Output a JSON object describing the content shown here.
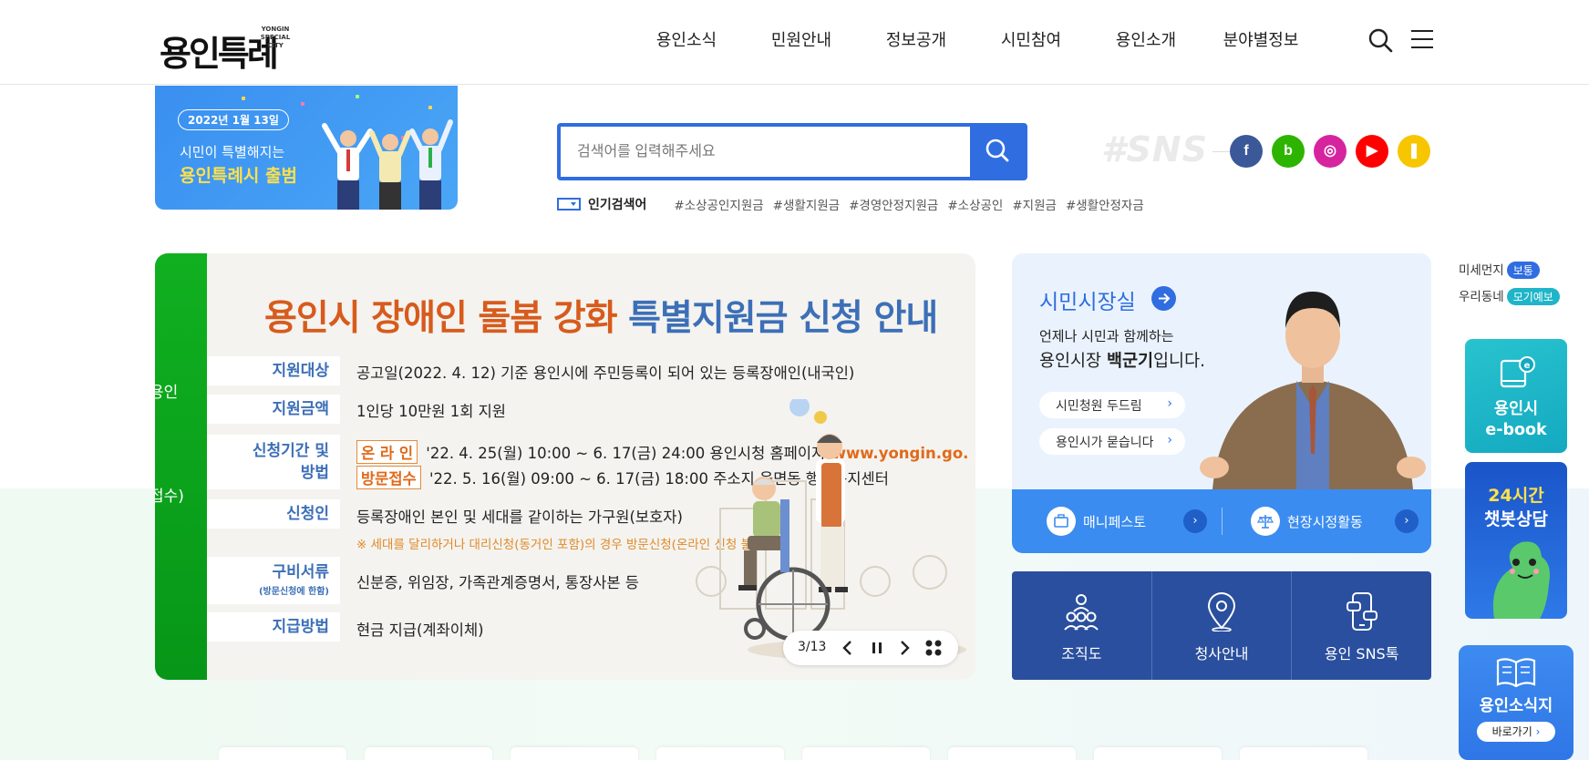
{
  "header": {
    "logo_text": "용인특례시",
    "logo_sub": "YONGIN SPECIAL CITY",
    "nav": [
      "용인소식",
      "민원안내",
      "정보공개",
      "시민참여",
      "용인소개",
      "분야별정보"
    ]
  },
  "promo": {
    "date": "2022년 1월 13일",
    "line1": "시민이 특별해지는",
    "line2": "용인특례시 출범"
  },
  "search": {
    "placeholder": "검색어를 입력해주세요",
    "popular_title": "인기검색어",
    "tags": [
      "#소상공인지원금",
      "#생활지원금",
      "#경영안정지원금",
      "#소상공인",
      "#지원금",
      "#생활안정자금"
    ]
  },
  "sns": {
    "label": "#SNS",
    "items": [
      {
        "name": "facebook",
        "glyph": "f",
        "color": "#3b5998"
      },
      {
        "name": "blog",
        "glyph": "b",
        "color": "#2db400"
      },
      {
        "name": "instagram",
        "glyph": "◎",
        "color": "#d6249f"
      },
      {
        "name": "youtube",
        "glyph": "▶",
        "color": "#ff0000"
      },
      {
        "name": "kakao",
        "glyph": "❚",
        "color": "#f7c600"
      }
    ]
  },
  "slider": {
    "strip_text_1": "용인",
    "strip_text_2": "접수)",
    "title_part1": "용인시 장애인 돌봄 강화",
    "title_part2": "특별지원금 신청 안내",
    "rows": {
      "target_label": "지원대상",
      "target_value": "공고일(2022. 4. 12) 기준 용인시에 주민등록이 되어 있는 등록장애인(내국인)",
      "amount_label": "지원금액",
      "amount_value": "1인당 10만원 1회 지원",
      "period_label_1": "신청기간 및",
      "period_label_2": "방법",
      "online_pill": "온 라 인",
      "online_text": "'22. 4. 25(월) 10:00 ~ 6. 17(금) 24:00 용인시청 홈페이지",
      "online_url": "(www.yongin.go.",
      "visit_pill": "방문접수",
      "visit_text": "'22. 5. 16(월) 09:00 ~ 6. 17(금) 18:00 주소지 읍면동 행정복지센터",
      "applicant_label": "신청인",
      "applicant_value": "등록장애인 본인 및 세대를 같이하는 가구원(보호자)",
      "applicant_note": "※ 세대를 달리하거나 대리신청(동거인 포함)의 경우 방문신청(온라인 신청 불가)",
      "docs_label": "구비서류",
      "docs_sub": "(방문신청에 한함)",
      "docs_value": "신분증, 위임장, 가족관계증명서, 통장사본 등",
      "pay_label": "지급방법",
      "pay_value": "현금 지급(계좌이체)"
    },
    "page": "3/13"
  },
  "mayor": {
    "title": "시민시장실",
    "desc1": "언제나 시민과 함께하는",
    "desc2_pre": "용인시장 ",
    "desc2_name": "백군기",
    "desc2_post": "입니다.",
    "link1": "시민청원 두드림",
    "link2": "용인시가 묻습니다",
    "bar_item1": "매니페스토",
    "bar_item2": "현장시정활동"
  },
  "quick": [
    {
      "label": "조직도",
      "icon": "org-chart-icon"
    },
    {
      "label": "청사안내",
      "icon": "map-pin-icon"
    },
    {
      "label": "용인 SNS톡",
      "icon": "smartphone-icon"
    }
  ],
  "side": {
    "dust_label": "미세먼지",
    "dust_status": "보통",
    "dust_color": "#2f6de1",
    "town_label": "우리동네",
    "town_status": "모기예보",
    "town_color": "#1fb5c9",
    "ebook_title_1": "용인시",
    "ebook_title_2": "e-book",
    "chatbot_title_1": "24시간",
    "chatbot_title_2": "챗봇상담",
    "news_title": "용인소식지",
    "news_button": "바로가기"
  },
  "colors": {
    "brand_blue": "#2f6de1",
    "deep_blue": "#2a4f9e",
    "strip_green": "#0a9f1b",
    "title_orange": "#d75b1d"
  }
}
